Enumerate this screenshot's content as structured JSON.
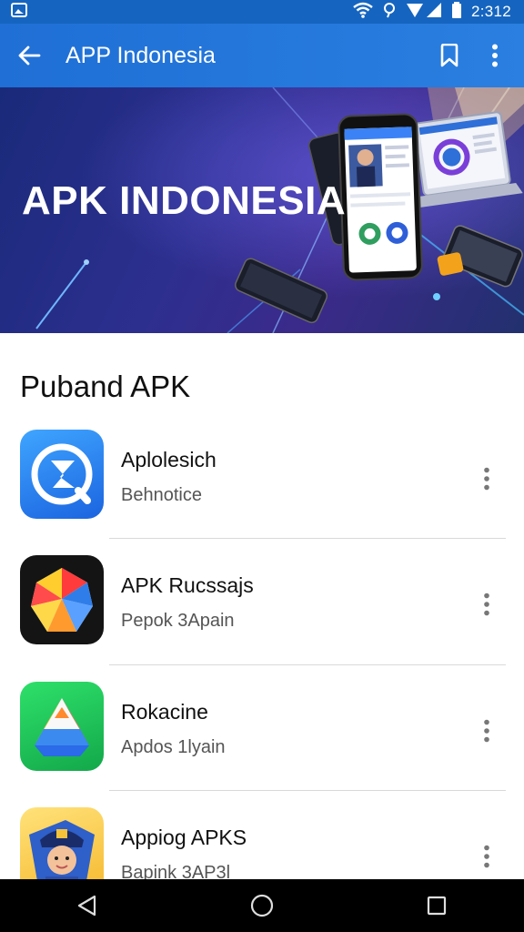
{
  "status_bar": {
    "time": "2:312",
    "icons": [
      "image-icon",
      "wifi-icon",
      "alarm-icon",
      "signal-icon",
      "battery-icon"
    ]
  },
  "app_bar": {
    "title": "APP Indonesia",
    "icons": [
      "back-arrow-icon",
      "bookmark-icon",
      "more-vert-icon"
    ]
  },
  "banner": {
    "title": "APK INDONESIA"
  },
  "list": {
    "section_title": "Puband APK",
    "items": [
      {
        "name": "Aplolesich",
        "subtitle": "Behnotice",
        "icon": "compass-app-icon"
      },
      {
        "name": "APK Rucssajs",
        "subtitle": "Pepok 3Apain",
        "icon": "colorful-polygon-app-icon"
      },
      {
        "name": "Rokacine",
        "subtitle": "Apdos 1lyain",
        "icon": "drive-triangle-app-icon"
      },
      {
        "name": "Appiog APKS",
        "subtitle": "Bapink 3AP3l",
        "icon": "police-avatar-app-icon"
      }
    ]
  },
  "nav_bar": {
    "icons": [
      "back-triangle-icon",
      "home-circle-icon",
      "recents-square-icon"
    ]
  },
  "colors": {
    "app_bar": "#1f6fd6",
    "status_bar": "#1565c0",
    "banner_dark": "#1a2a7a",
    "nav_bar": "#000000"
  }
}
